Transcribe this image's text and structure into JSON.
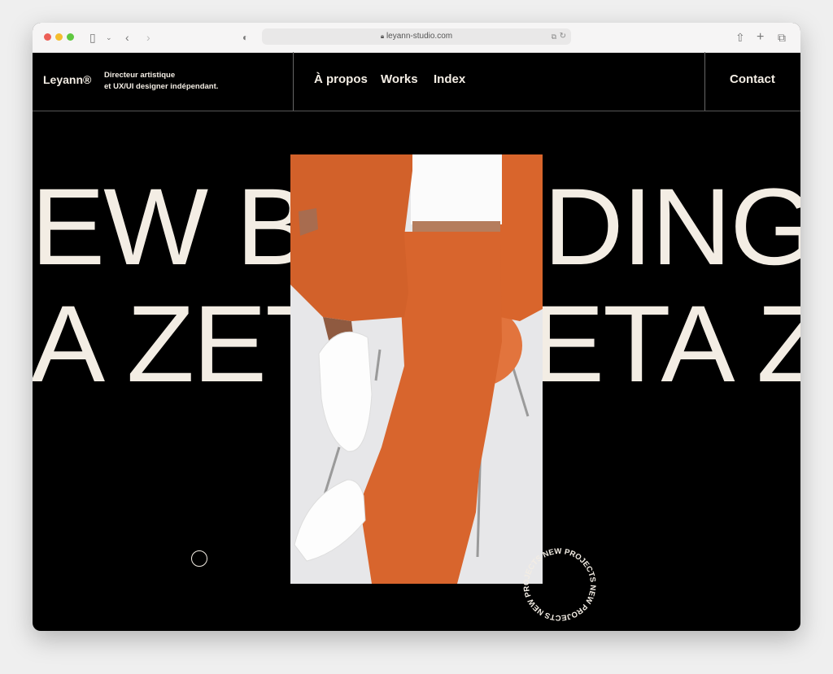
{
  "browser": {
    "url": "leyann-studio.com",
    "icons": [
      "sidebar-icon",
      "chevron-down-icon",
      "back-icon",
      "forward-icon",
      "shield-icon",
      "lock-icon",
      "translate-icon",
      "reload-icon",
      "share-icon",
      "new-tab-icon",
      "tabs-icon"
    ]
  },
  "nav": {
    "logo": "Leyann®",
    "tagline_line1": "Directeur artistique",
    "tagline_line2": "et UX/UI designer indépendant.",
    "items": [
      {
        "label": "À propos"
      },
      {
        "label": "Works"
      },
      {
        "label": "Index"
      }
    ],
    "contact": "Contact"
  },
  "hero": {
    "row1_left": "EW B",
    "row1_right": "DING",
    "row2_left": "A ZET",
    "row2_right": "ETA Z",
    "badge_text": "NEW PROJECTS NEW PROJECTS NEW PROJECTS ",
    "text_color": "#f3ede4",
    "accent": "#d9652c"
  }
}
